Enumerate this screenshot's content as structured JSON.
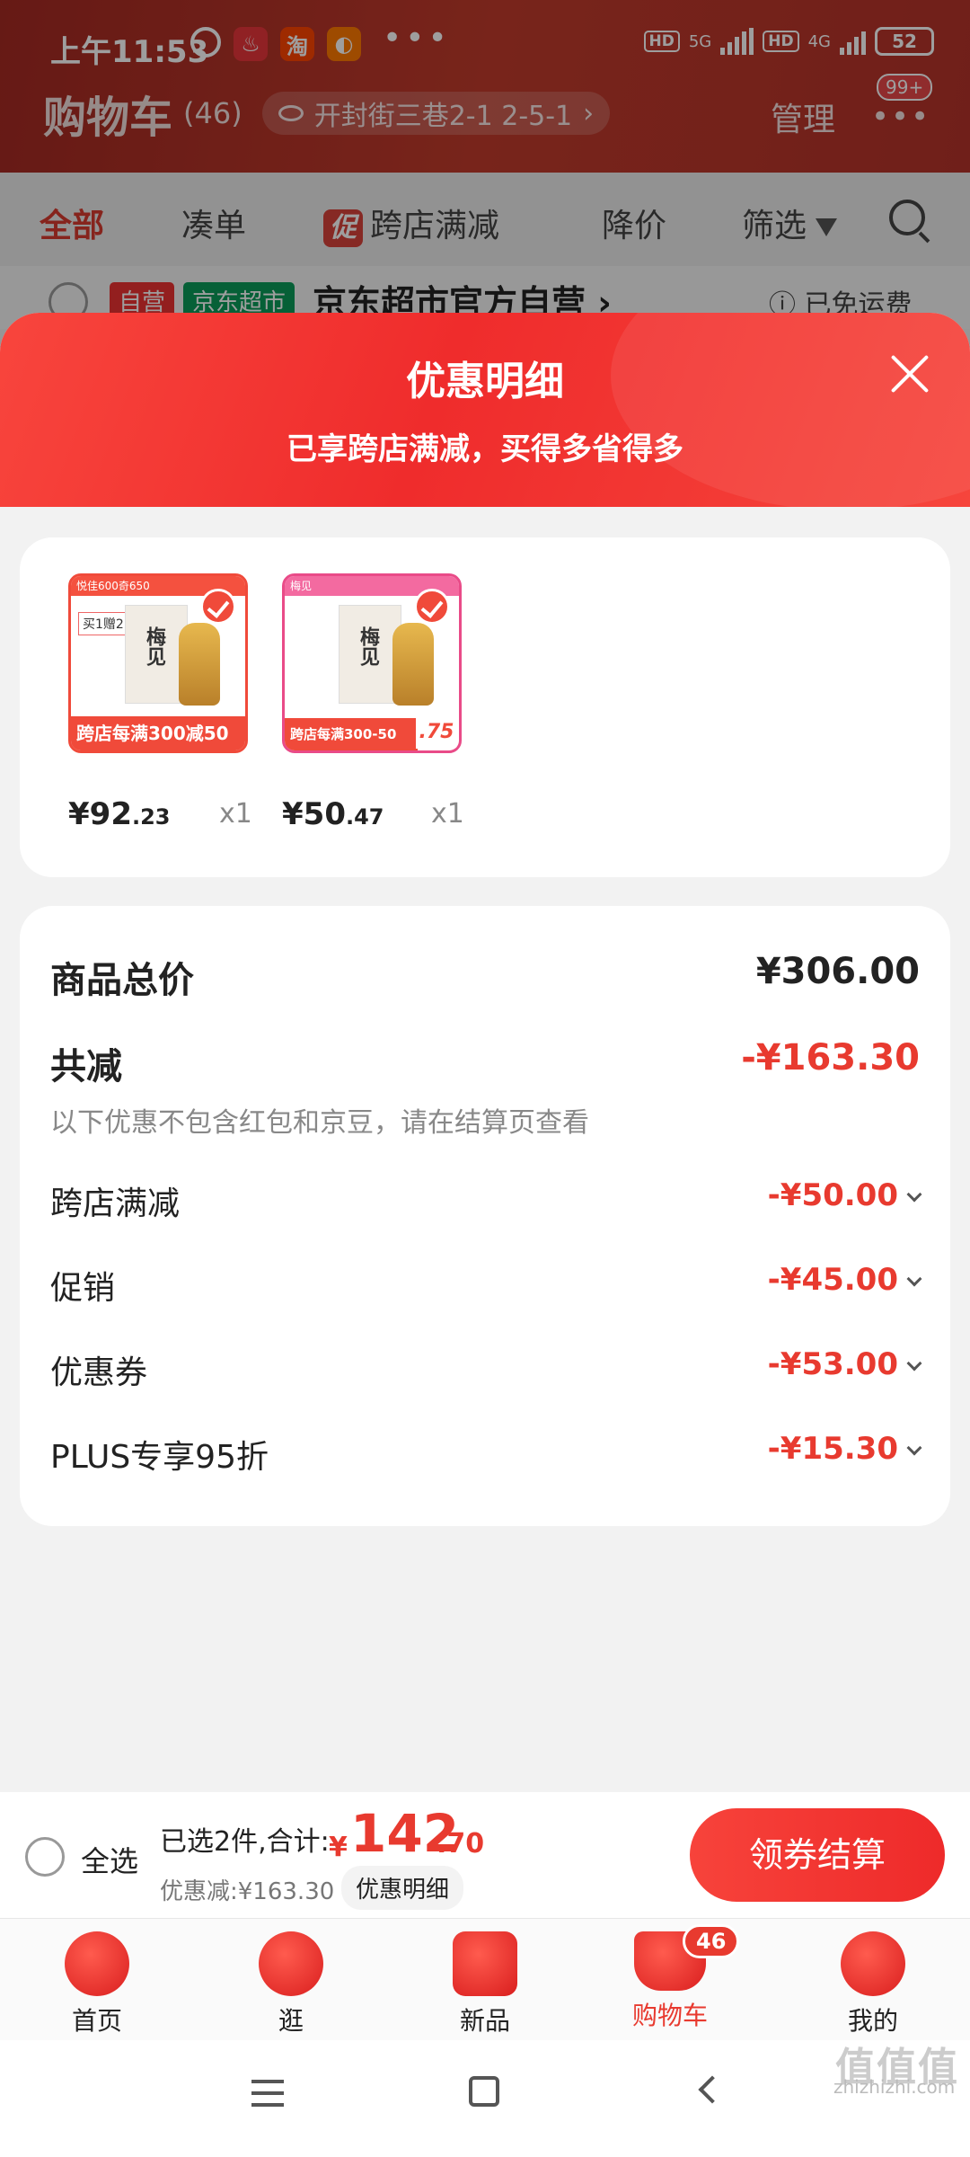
{
  "status_bar": {
    "time": "上午11:53",
    "net1": "5G",
    "net2": "4G",
    "hd": "HD",
    "battery": "52",
    "app2_label": "淘"
  },
  "cart_header": {
    "title": "购物车",
    "count": "(46)",
    "address": "开封街三巷2-1 2-5-1",
    "manage": "管理",
    "more_badge": "99+"
  },
  "tabs": {
    "all": "全部",
    "combine": "凑单",
    "promo_badge": "促",
    "cross_store": "跨店满减",
    "price_drop": "降价",
    "filter": "筛选"
  },
  "store_row": {
    "tag_self": "自营",
    "tag_jd": "京东超市",
    "name": "京东超市官方自营 ›",
    "free_shipping": "ⓘ 已免运费"
  },
  "sheet": {
    "title": "优惠明细",
    "subtitle": "已享跨店满减，买得多省得多"
  },
  "products": [
    {
      "price_int": "¥92",
      "price_dec": ".23",
      "qty": "x1",
      "top_strip": "悦佳600奇650",
      "gift": "买1赠2",
      "box_text": "梅见",
      "promo": "跨店每满300减50"
    },
    {
      "price_int": "¥50",
      "price_dec": ".47",
      "qty": "x1",
      "top_strip": "梅见",
      "box_text": "梅见",
      "promo": "跨店每满300-50",
      "price_tag": ".75"
    }
  ],
  "detail": {
    "total_label": "商品总价",
    "total_value": "¥306.00",
    "reduce_label": "共减",
    "reduce_value": "-¥163.30",
    "note": "以下优惠不包含红包和京豆，请在结算页查看",
    "items": [
      {
        "label": "跨店满减",
        "value": "-¥50.00"
      },
      {
        "label": "促销",
        "value": "-¥45.00"
      },
      {
        "label": "优惠券",
        "value": "-¥53.00"
      },
      {
        "label": "PLUS专享95折",
        "value": "-¥15.30"
      }
    ]
  },
  "checkout": {
    "select_all": "全选",
    "selected_info": "已选2件,合计:",
    "yen": "¥",
    "total_int": "142",
    "total_dec": ".70",
    "discount": "优惠减:¥163.30",
    "detail_link": "优惠明细",
    "button": "领券结算"
  },
  "nav": [
    {
      "label": "首页",
      "icon": "home-icon"
    },
    {
      "label": "逛",
      "icon": "browse-icon"
    },
    {
      "label": "新品",
      "icon": "new-icon"
    },
    {
      "label": "购物车",
      "icon": "cart-icon",
      "badge": "46"
    },
    {
      "label": "我的",
      "icon": "profile-icon"
    }
  ],
  "watermark": {
    "logo": "值值值",
    "text": "zhizhizhi.com"
  }
}
